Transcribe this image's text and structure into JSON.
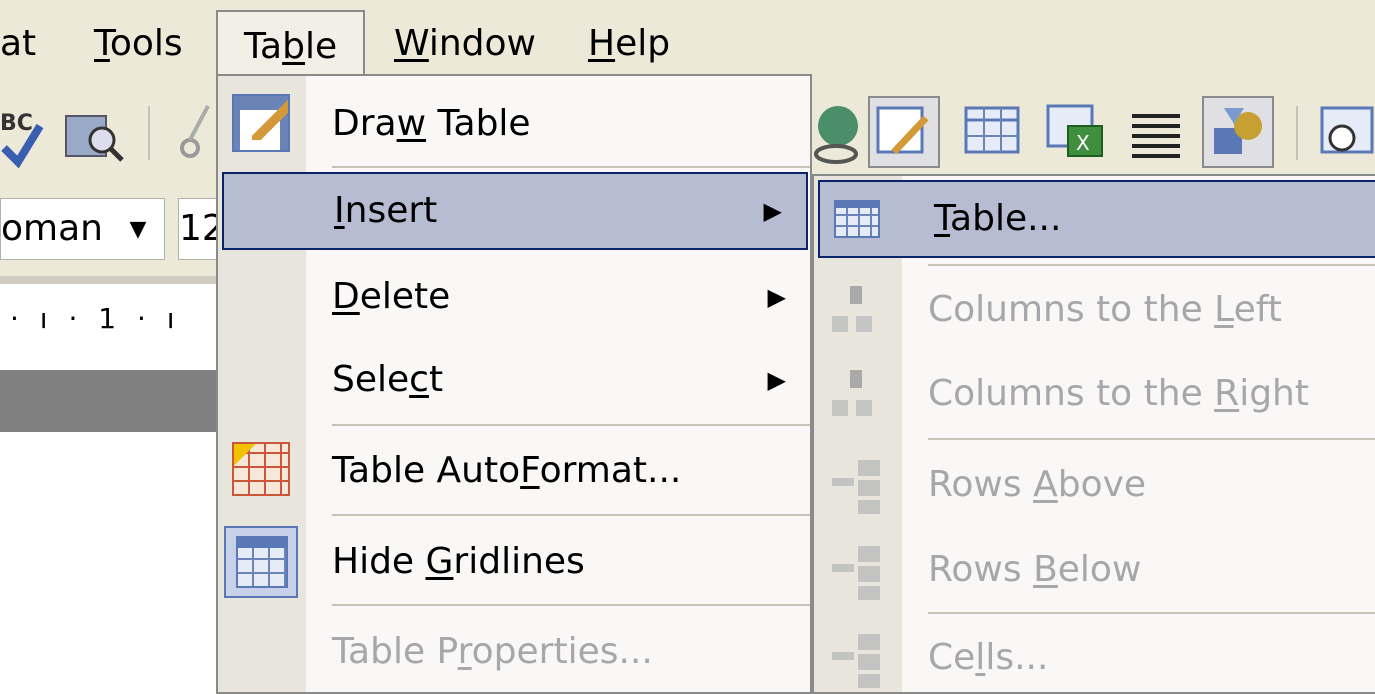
{
  "menubar": {
    "items": [
      {
        "text": "at",
        "underline": ""
      },
      {
        "pre": "",
        "u": "T",
        "post": "ools"
      },
      {
        "pre": "Ta",
        "u": "b",
        "post": "le"
      },
      {
        "pre": "",
        "u": "W",
        "post": "indow"
      },
      {
        "pre": "",
        "u": "H",
        "post": "elp"
      }
    ]
  },
  "formatting": {
    "font_name": "oman",
    "font_size": "12"
  },
  "ruler": {
    "text": "· ı · 1 · ı"
  },
  "table_menu": {
    "items": [
      {
        "pre": "Dra",
        "u": "w",
        "post": " Table",
        "submenu": false,
        "disabled": false,
        "icon": "draw-table-icon"
      },
      {
        "pre": "",
        "u": "I",
        "post": "nsert",
        "submenu": true,
        "disabled": false,
        "highlighted": true
      },
      {
        "pre": "",
        "u": "D",
        "post": "elete",
        "submenu": true,
        "disabled": false
      },
      {
        "pre": "Sele",
        "u": "c",
        "post": "t",
        "submenu": true,
        "disabled": false
      },
      {
        "pre": "Table Auto",
        "u": "F",
        "post": "ormat...",
        "submenu": false,
        "disabled": false,
        "icon": "autoformat-icon"
      },
      {
        "pre": "Hide ",
        "u": "G",
        "post": "ridlines",
        "submenu": false,
        "disabled": false,
        "icon": "gridlines-icon"
      },
      {
        "pre": "Table P",
        "u": "r",
        "post": "operties...",
        "submenu": false,
        "disabled": true
      }
    ],
    "arrow": "▶"
  },
  "insert_submenu": {
    "items": [
      {
        "pre": "",
        "u": "T",
        "post": "able...",
        "disabled": false,
        "highlighted": true
      },
      {
        "pre": "Columns to the ",
        "u": "L",
        "post": "eft",
        "disabled": true
      },
      {
        "pre": "Columns to the ",
        "u": "R",
        "post": "ight",
        "disabled": true
      },
      {
        "pre": "Rows ",
        "u": "A",
        "post": "bove",
        "disabled": true
      },
      {
        "pre": "Rows ",
        "u": "B",
        "post": "elow",
        "disabled": true
      },
      {
        "pre": "Ce",
        "u": "l",
        "post": "ls...",
        "disabled": true
      }
    ]
  },
  "colors": {
    "menu_highlight": "#b6bdd2",
    "highlight_border": "#0a246a",
    "disabled_text": "#a7a6aa",
    "chrome": "#ece9d8"
  }
}
